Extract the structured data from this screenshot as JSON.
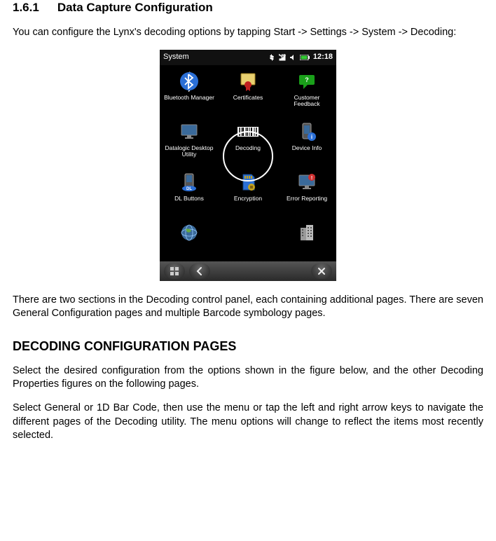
{
  "section": {
    "number": "1.6.1",
    "title": "Data Capture Configuration"
  },
  "para1": "You can configure the Lynx's decoding options by tapping Start -> Settings -> System -> Decoding:",
  "para2": "There are two sections in the Decoding control panel, each containing additional pages. There are seven General Configuration pages and multiple Barcode symbology pages.",
  "heading2": "DECODING CONFIGURATION PAGES",
  "para3": "Select the desired configuration from the options shown in the figure below, and the other Decoding Properties figures on the following pages.",
  "para4": "Select General or 1D Bar Code, then use the menu or tap the left and right arrow keys to navigate the different pages of the Decoding utility. The menu options will change to reflect the items most recently selected.",
  "device": {
    "statusTitle": "System",
    "time": "12:18",
    "apps": [
      {
        "label": "Bluetooth Manager",
        "icon": "bluetooth"
      },
      {
        "label": "Certificates",
        "icon": "certificate"
      },
      {
        "label": "Customer Feedback",
        "icon": "feedback"
      },
      {
        "label": "Datalogic Desktop Utility",
        "icon": "display"
      },
      {
        "label": "Decoding",
        "icon": "barcode"
      },
      {
        "label": "Device Info",
        "icon": "deviceinfo"
      },
      {
        "label": "DL Buttons",
        "icon": "dlbuttons"
      },
      {
        "label": "Encryption",
        "icon": "sdcard"
      },
      {
        "label": "Error Reporting",
        "icon": "error"
      },
      {
        "label": "",
        "icon": "globe"
      },
      {
        "label": "",
        "icon": ""
      },
      {
        "label": "",
        "icon": "building"
      }
    ]
  }
}
